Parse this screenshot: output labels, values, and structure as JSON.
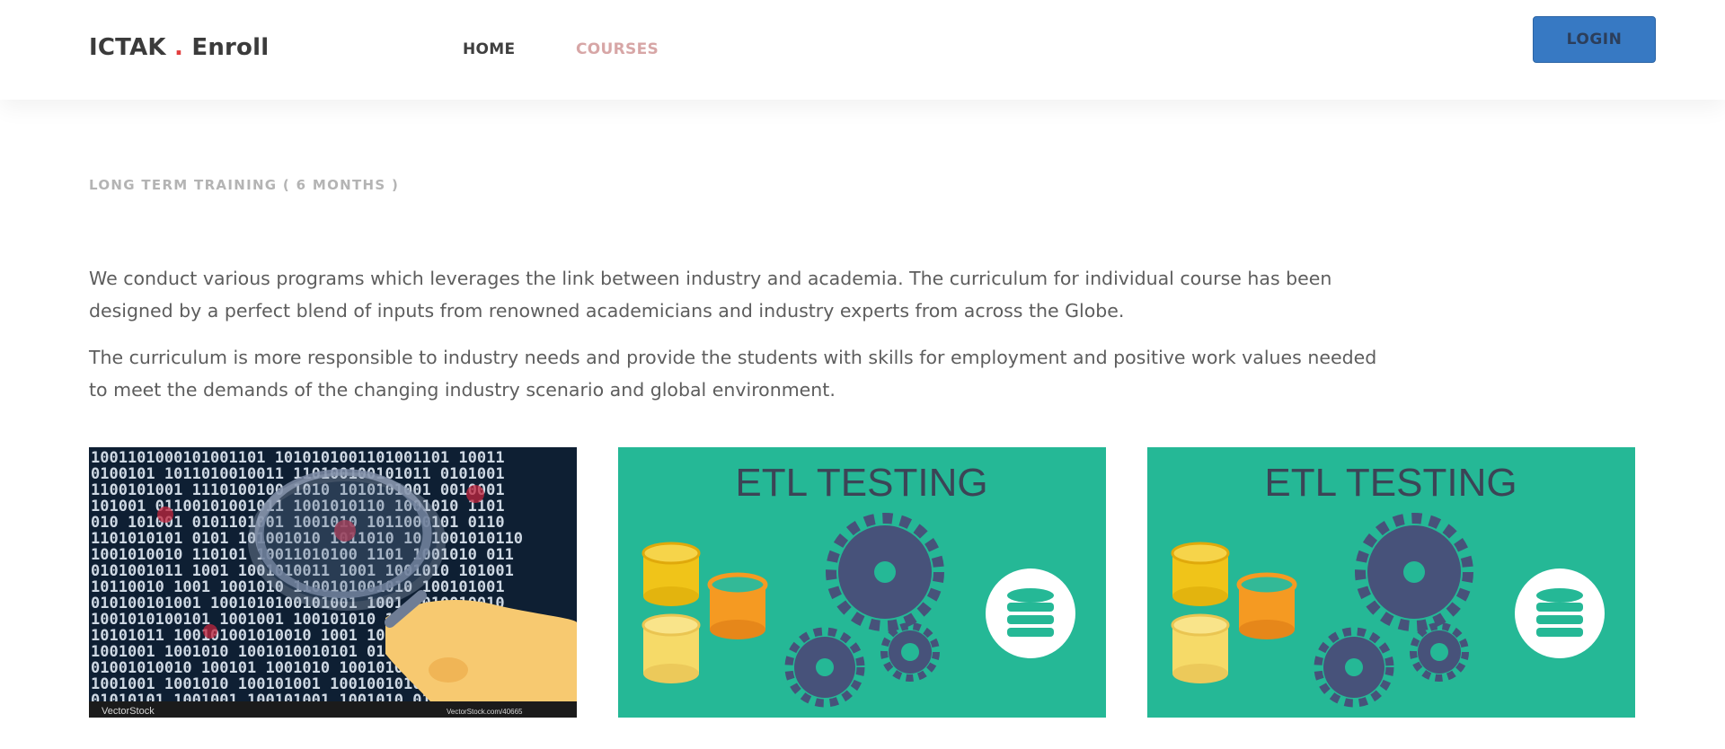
{
  "header": {
    "brand_name": "ICTAK",
    "brand_dot": ".",
    "brand_suffix": "Enroll",
    "nav": {
      "home": "HOME",
      "courses": "COURSES"
    },
    "login_label": "LOGIN"
  },
  "main": {
    "section_title": "LONG TERM TRAINING ( 6 MONTHS )",
    "paragraphs": [
      "We conduct various programs which leverages the link between industry and academia. The curriculum for individual course has been designed by a perfect blend of inputs from renowned academicians and industry experts from across the Globe.",
      "The curriculum is more responsible to industry needs and provide the students with skills for employment and positive work values needed to meet the demands of the changing industry scenario and global environment."
    ],
    "cards": [
      {
        "image_icon": "binary-magnifier-illustration",
        "watermark_left": "VectorStock",
        "watermark_right": "VectorStock.com/40665"
      },
      {
        "image_icon": "etl-testing-illustration",
        "title": "ETL TESTING"
      },
      {
        "image_icon": "etl-testing-illustration",
        "title": "ETL TESTING"
      }
    ]
  },
  "colors": {
    "accent_blue": "#3779c3",
    "courses_link": "#d7a6a6",
    "brand_dot": "#e23e3e",
    "etl_background": "#25b896",
    "gear": "#47527a"
  }
}
